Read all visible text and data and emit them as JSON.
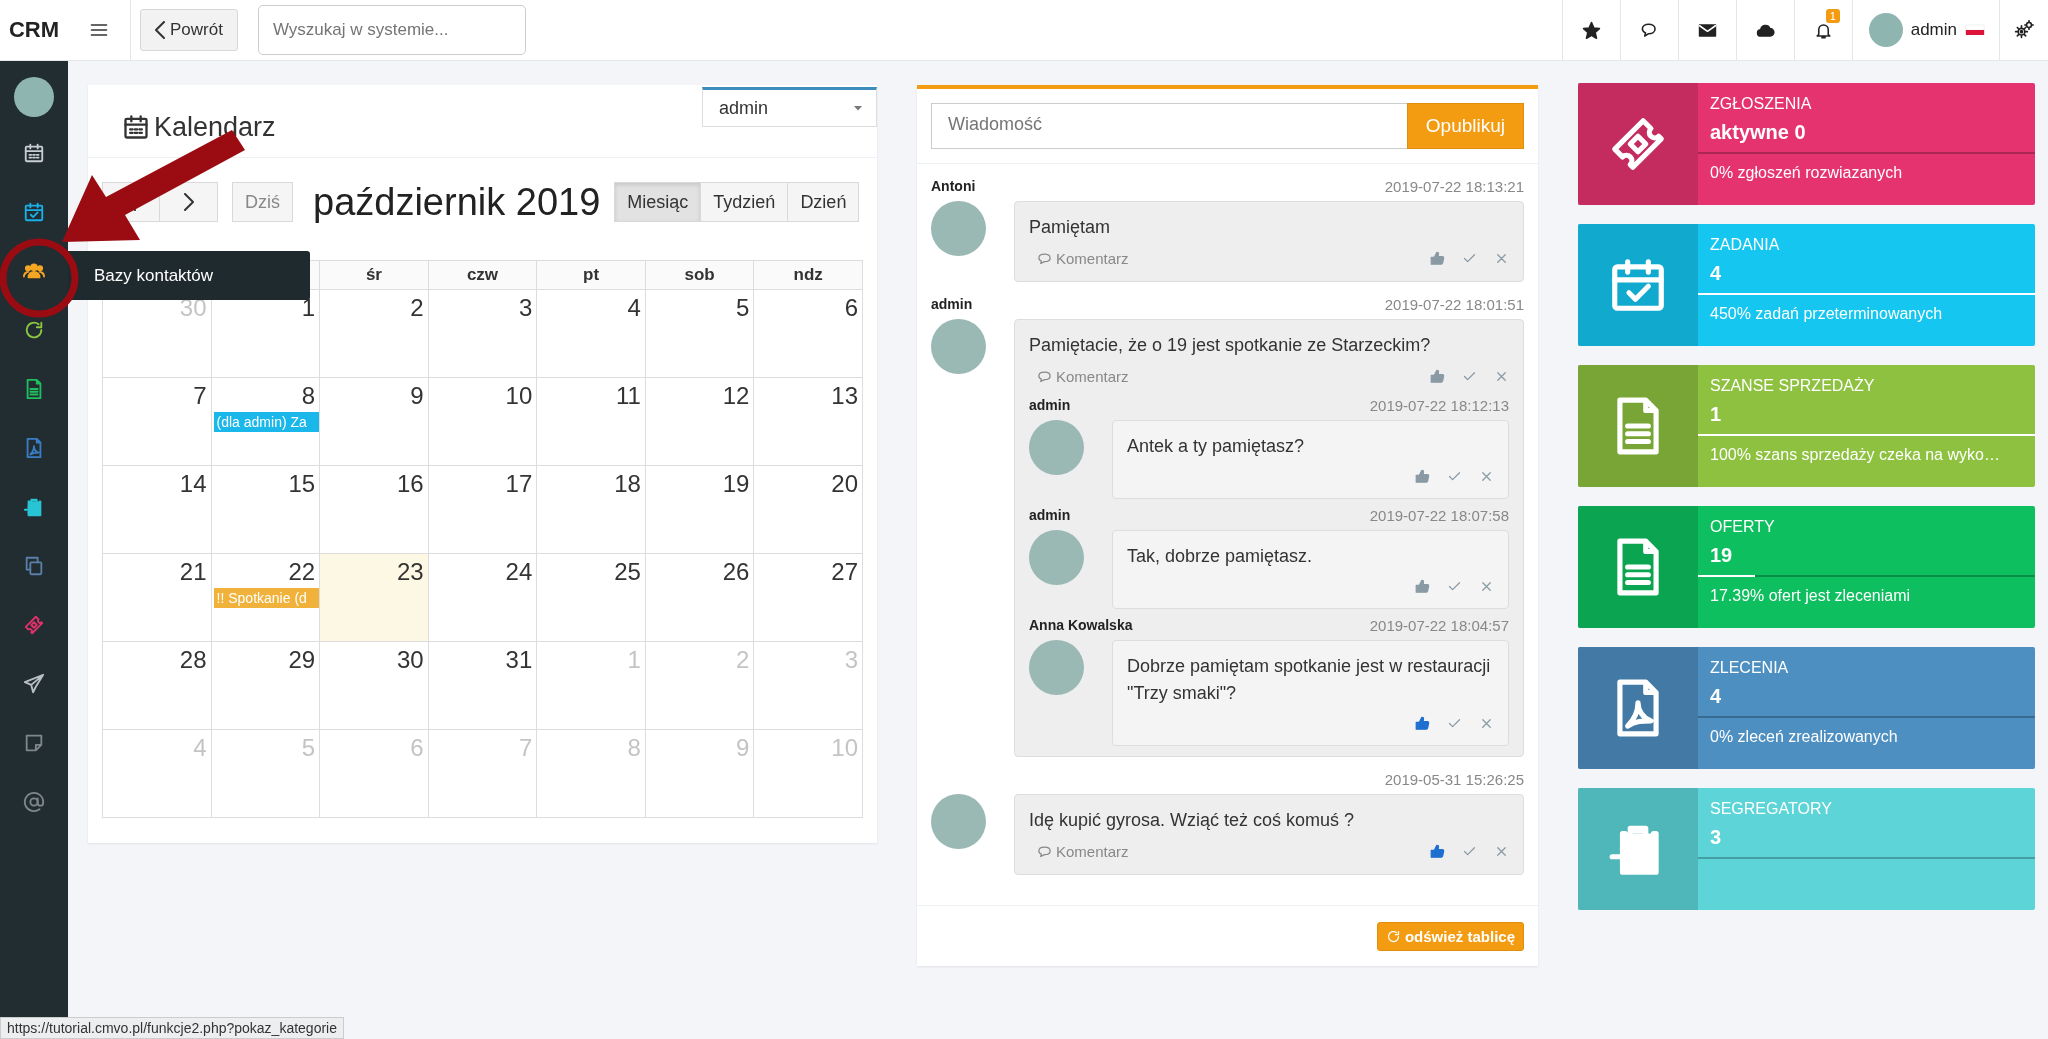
{
  "topbar": {
    "logo": "CRM",
    "back_label": "Powrót",
    "search": {
      "placeholder": "Wyszukaj w systemie..."
    },
    "icons": [
      {
        "kind": "star"
      },
      {
        "kind": "comments"
      },
      {
        "kind": "envelope"
      },
      {
        "kind": "cloud"
      },
      {
        "kind": "bell",
        "badge": "1"
      }
    ],
    "user": "admin"
  },
  "sidebar": {
    "items": [
      {
        "kind": "calendar",
        "color": "#c8ced3"
      },
      {
        "kind": "calendar-check",
        "color": "#1ab0e8"
      },
      {
        "kind": "users",
        "color": "#f5a623"
      },
      {
        "kind": "refresh",
        "color": "#8cc63f"
      },
      {
        "kind": "document",
        "color": "#1fbf5f"
      },
      {
        "kind": "pdf-document",
        "color": "#3b7dc4"
      },
      {
        "kind": "clipboard-arrow",
        "color": "#29c4d4"
      },
      {
        "kind": "copy",
        "color": "#5a7fa8"
      },
      {
        "kind": "ticket",
        "color": "#e0316a"
      },
      {
        "kind": "paper-plane",
        "color": "#b9c0c4"
      },
      {
        "kind": "note",
        "color": "#7e878c"
      },
      {
        "kind": "at-sign",
        "color": "#7e878c"
      }
    ],
    "tooltip": "Bazy kontaktów"
  },
  "calendar": {
    "title": "Kalendarz",
    "user_select": "admin",
    "today_label": "Dziś",
    "month_title": "październik 2019",
    "views": [
      {
        "label": "Miesiąc",
        "selected": true
      },
      {
        "label": "Tydzień",
        "selected": false
      },
      {
        "label": "Dzień",
        "selected": false
      }
    ],
    "weekdays": [
      "śr",
      "czw",
      "pt",
      "sob",
      "ndz"
    ],
    "weeks": [
      [
        {
          "day": "30",
          "outside_month": true,
          "today": false
        },
        {
          "day": "1",
          "outside_month": false,
          "today": false
        },
        {
          "day": "2",
          "outside_month": false,
          "today": false
        },
        {
          "day": "3",
          "outside_month": false,
          "today": false
        },
        {
          "day": "4",
          "outside_month": false,
          "today": false
        },
        {
          "day": "5",
          "outside_month": false,
          "today": false
        },
        {
          "day": "6",
          "outside_month": false,
          "today": false
        }
      ],
      [
        {
          "day": "7",
          "outside_month": false,
          "today": false
        },
        {
          "day": "8",
          "outside_month": false,
          "today": false,
          "events": [
            {
              "text": "(dla admin) Za",
              "color": "#1ab7ea"
            }
          ]
        },
        {
          "day": "9",
          "outside_month": false,
          "today": false
        },
        {
          "day": "10",
          "outside_month": false,
          "today": false
        },
        {
          "day": "11",
          "outside_month": false,
          "today": false
        },
        {
          "day": "12",
          "outside_month": false,
          "today": false
        },
        {
          "day": "13",
          "outside_month": false,
          "today": false
        }
      ],
      [
        {
          "day": "14",
          "outside_month": false,
          "today": false
        },
        {
          "day": "15",
          "outside_month": false,
          "today": false
        },
        {
          "day": "16",
          "outside_month": false,
          "today": false
        },
        {
          "day": "17",
          "outside_month": false,
          "today": false
        },
        {
          "day": "18",
          "outside_month": false,
          "today": false
        },
        {
          "day": "19",
          "outside_month": false,
          "today": false
        },
        {
          "day": "20",
          "outside_month": false,
          "today": false
        }
      ],
      [
        {
          "day": "21",
          "outside_month": false,
          "today": false
        },
        {
          "day": "22",
          "outside_month": false,
          "today": false,
          "events": [
            {
              "text": "!! Spotkanie (d",
              "color": "#f0b23a"
            }
          ]
        },
        {
          "day": "23",
          "outside_month": false,
          "today": true
        },
        {
          "day": "24",
          "outside_month": false,
          "today": false
        },
        {
          "day": "25",
          "outside_month": false,
          "today": false
        },
        {
          "day": "26",
          "outside_month": false,
          "today": false
        },
        {
          "day": "27",
          "outside_month": false,
          "today": false
        }
      ],
      [
        {
          "day": "28",
          "outside_month": false,
          "today": false
        },
        {
          "day": "29",
          "outside_month": false,
          "today": false
        },
        {
          "day": "30",
          "outside_month": false,
          "today": false
        },
        {
          "day": "31",
          "outside_month": false,
          "today": false
        },
        {
          "day": "1",
          "outside_month": true,
          "today": false
        },
        {
          "day": "2",
          "outside_month": true,
          "today": false
        },
        {
          "day": "3",
          "outside_month": true,
          "today": false
        }
      ],
      [
        {
          "day": "4",
          "outside_month": true,
          "today": false
        },
        {
          "day": "5",
          "outside_month": true,
          "today": false
        },
        {
          "day": "6",
          "outside_month": true,
          "today": false
        },
        {
          "day": "7",
          "outside_month": true,
          "today": false
        },
        {
          "day": "8",
          "outside_month": true,
          "today": false
        },
        {
          "day": "9",
          "outside_month": true,
          "today": false
        },
        {
          "day": "10",
          "outside_month": true,
          "today": false
        }
      ]
    ]
  },
  "messages": {
    "input": {
      "placeholder": "Wiadomość"
    },
    "publish_label": "Opublikuj",
    "refresh_label": "odśwież tablicę",
    "posts": [
      {
        "author": "Antoni",
        "time": "2019-07-22 18:13:21",
        "text": "Pamiętam",
        "comment_label": "Komentarz",
        "liked": false
      },
      {
        "author": "admin",
        "time": "2019-07-22 18:01:51",
        "text": "Pamiętacie, że o 19 jest spotkanie ze Starzeckim?",
        "comment_label": "Komentarz",
        "liked": false,
        "replies": [
          {
            "author": "admin",
            "time": "2019-07-22 18:12:13",
            "text": "Antek a ty pamiętasz?",
            "liked": false
          },
          {
            "author": "admin",
            "time": "2019-07-22 18:07:58",
            "text": "Tak, dobrze pamiętasz.",
            "liked": false
          },
          {
            "author": "Anna Kowalska",
            "time": "2019-07-22 18:04:57",
            "text": "Dobrze pamiętam spotkanie jest w restauracji \"Trzy smaki\"?",
            "liked": true
          }
        ]
      },
      {
        "time": "2019-05-31 15:26:25",
        "text": "Idę kupić gyrosa. Wziąć też coś komuś ?",
        "comment_label": "Komentarz",
        "liked": true
      }
    ]
  },
  "tiles": [
    {
      "kind": "ticket",
      "color": "#e5336f",
      "title": "ZGŁOSZENIA",
      "value": "aktywne 0",
      "level": 0,
      "subtitle": "0% zgłoszeń rozwiazanych"
    },
    {
      "kind": "calendar-check",
      "color": "#14c6f0",
      "title": "ZADANIA",
      "value": "4",
      "level": 1,
      "subtitle": "450% zadań przeterminowanych"
    },
    {
      "kind": "document",
      "color": "#8dc13f",
      "title": "SZANSE SPRZEDAŻY",
      "value": "1",
      "level": 1,
      "subtitle": "100% szans sprzedaży czeka na wyko…"
    },
    {
      "kind": "document",
      "color": "#0dbf5e",
      "title": "OFERTY",
      "value": "19",
      "level": 0.17,
      "subtitle": "17.39% ofert jest zleceniami"
    },
    {
      "kind": "pdf-document",
      "color": "#4d8fc0",
      "title": "ZLECENIA",
      "value": "4",
      "level": 0,
      "subtitle": "0% zleceń zrealizowanych"
    },
    {
      "kind": "clipboard-arrow",
      "color": "#5dd5d8",
      "title": "SEGREGATORY",
      "value": "3",
      "level": 0
    }
  ],
  "status_bar": "https://tutorial.cmvo.pl/funkcje2.php?pokaz_kategorie"
}
